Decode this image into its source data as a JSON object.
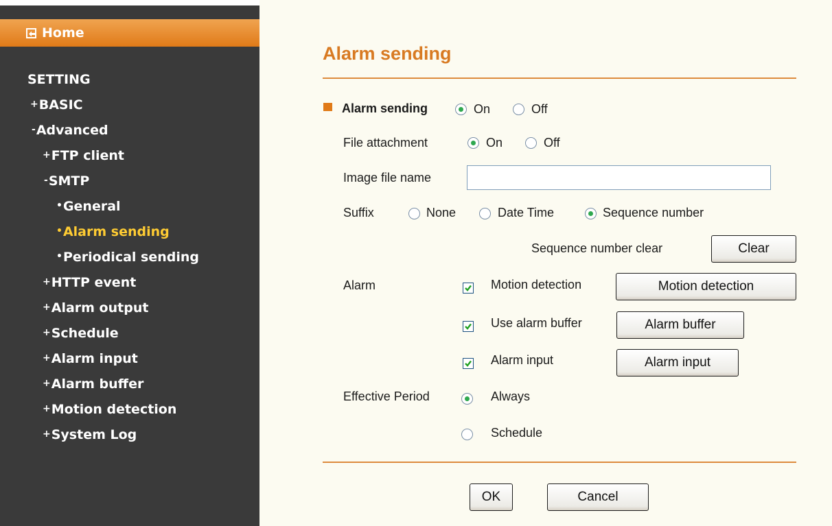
{
  "sidebar": {
    "home_label": "Home",
    "setting_heading": "SETTING",
    "items": [
      {
        "prefix": "+",
        "label": "BASIC"
      },
      {
        "prefix": "-",
        "label": "Advanced"
      },
      {
        "prefix": "+",
        "label": "FTP client"
      },
      {
        "prefix": "-",
        "label": "SMTP"
      },
      {
        "prefix": "•",
        "label": "General"
      },
      {
        "prefix": "•",
        "label": "Alarm sending",
        "active": true
      },
      {
        "prefix": "•",
        "label": "Periodical sending"
      },
      {
        "prefix": "+",
        "label": "HTTP event"
      },
      {
        "prefix": "+",
        "label": "Alarm output"
      },
      {
        "prefix": "+",
        "label": "Schedule"
      },
      {
        "prefix": "+",
        "label": "Alarm input"
      },
      {
        "prefix": "+",
        "label": "Alarm buffer"
      },
      {
        "prefix": "+",
        "label": "Motion detection"
      },
      {
        "prefix": "+",
        "label": "System Log"
      }
    ]
  },
  "main": {
    "title": "Alarm sending",
    "alarm_sending": {
      "label": "Alarm sending",
      "on": "On",
      "off": "Off",
      "value": "On"
    },
    "file_attachment": {
      "label": "File attachment",
      "on": "On",
      "off": "Off",
      "value": "On"
    },
    "image_file_name": {
      "label": "Image file name",
      "value": "",
      "placeholder": ""
    },
    "suffix": {
      "label": "Suffix",
      "options": [
        "None",
        "Date Time",
        "Sequence number"
      ],
      "value": "Sequence number"
    },
    "sequence_clear": {
      "label": "Sequence number clear",
      "button": "Clear"
    },
    "alarm": {
      "label": "Alarm",
      "items": [
        {
          "label": "Motion detection",
          "checked": true,
          "button": "Motion detection"
        },
        {
          "label": "Use alarm buffer",
          "checked": true,
          "button": "Alarm buffer"
        },
        {
          "label": "Alarm input",
          "checked": true,
          "button": "Alarm input"
        }
      ]
    },
    "effective_period": {
      "label": "Effective Period",
      "options": [
        "Always",
        "Schedule"
      ],
      "value": "Always"
    },
    "ok_label": "OK",
    "cancel_label": "Cancel"
  },
  "colors": {
    "accent": "#e07a18",
    "sidebar_bg": "#3a3a3a",
    "active_nav": "#ffcc33",
    "content_bg": "#fcfbf1",
    "title": "#d87a22"
  }
}
